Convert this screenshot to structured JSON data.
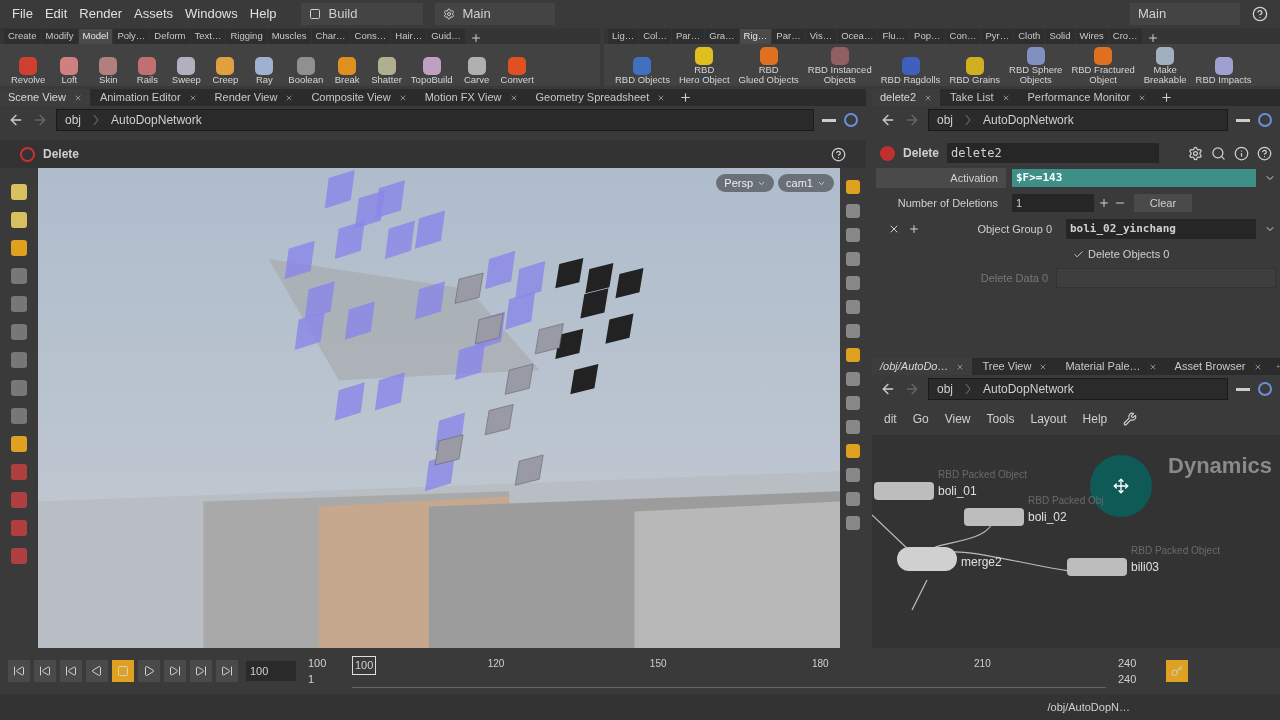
{
  "menu": [
    "File",
    "Edit",
    "Render",
    "Assets",
    "Windows",
    "Help"
  ],
  "desktop": "Build",
  "context": "Main",
  "right_context": "Main",
  "shelf_left": {
    "tabs": [
      {
        "label": "Create",
        "selected": false
      },
      {
        "label": "Modify",
        "selected": false
      },
      {
        "label": "Model",
        "selected": true
      },
      {
        "label": "Poly…",
        "selected": false
      },
      {
        "label": "Deform",
        "selected": false
      },
      {
        "label": "Text…",
        "selected": false
      },
      {
        "label": "Rigging",
        "selected": false
      },
      {
        "label": "Muscles",
        "selected": false
      },
      {
        "label": "Char…",
        "selected": false
      },
      {
        "label": "Cons…",
        "selected": false
      },
      {
        "label": "Hair…",
        "selected": false
      },
      {
        "label": "Guid…",
        "selected": false
      }
    ],
    "tools": [
      {
        "label": "Revolve",
        "color": "#d04030"
      },
      {
        "label": "Loft",
        "color": "#d08080"
      },
      {
        "label": "Skin",
        "color": "#b08080"
      },
      {
        "label": "Rails",
        "color": "#c07070"
      },
      {
        "label": "Sweep",
        "color": "#b0b0c0"
      },
      {
        "label": "Creep",
        "color": "#e0a040"
      },
      {
        "label": "Ray",
        "color": "#a0b0d0"
      },
      {
        "label": "Boolean",
        "color": "#909090"
      },
      {
        "label": "Break",
        "color": "#e09020"
      },
      {
        "label": "Shatter",
        "color": "#b0b090"
      },
      {
        "label": "TopoBuild",
        "color": "#c0a0c0"
      },
      {
        "label": "Carve",
        "color": "#b0b0b0"
      },
      {
        "label": "Convert",
        "color": "#e05020"
      }
    ]
  },
  "shelf_right": {
    "tabs": [
      {
        "label": "Lig…",
        "selected": false
      },
      {
        "label": "Col…",
        "selected": false
      },
      {
        "label": "Par…",
        "selected": false
      },
      {
        "label": "Gra…",
        "selected": false
      },
      {
        "label": "Rig…",
        "selected": true
      },
      {
        "label": "Par…",
        "selected": false
      },
      {
        "label": "Vis…",
        "selected": false
      },
      {
        "label": "Ocea…",
        "selected": false
      },
      {
        "label": "Flu…",
        "selected": false
      },
      {
        "label": "Pop…",
        "selected": false
      },
      {
        "label": "Con…",
        "selected": false
      },
      {
        "label": "Pyr…",
        "selected": false
      },
      {
        "label": "Cloth",
        "selected": false
      },
      {
        "label": "Solid",
        "selected": false
      },
      {
        "label": "Wires",
        "selected": false
      },
      {
        "label": "Cro…",
        "selected": false
      }
    ],
    "tools": [
      {
        "label": "RBD Objects",
        "color": "#4070c0"
      },
      {
        "label": "RBD\nHero Object",
        "color": "#e0c020"
      },
      {
        "label": "RBD\nGlued Objects",
        "color": "#e07020"
      },
      {
        "label": "RBD Instanced\nObjects",
        "color": "#906060"
      },
      {
        "label": "RBD Ragdolls",
        "color": "#4060c0"
      },
      {
        "label": "RBD Grains",
        "color": "#d0b020"
      },
      {
        "label": "RBD Sphere\nObjects",
        "color": "#8090c0"
      },
      {
        "label": "RBD Fractured\nObject",
        "color": "#e07020"
      },
      {
        "label": "Make\nBreakable",
        "color": "#a0b0c0"
      },
      {
        "label": "RBD Impacts",
        "color": "#a0a0d0"
      }
    ]
  },
  "scene_pane": {
    "tabs": [
      {
        "label": "Scene View",
        "selected": true
      },
      {
        "label": "Animation Editor",
        "selected": false
      },
      {
        "label": "Render View",
        "selected": false
      },
      {
        "label": "Composite View",
        "selected": false
      },
      {
        "label": "Motion FX View",
        "selected": false
      },
      {
        "label": "Geometry Spreadsheet",
        "selected": false
      }
    ],
    "path": [
      "obj",
      "AutoDopNetwork"
    ],
    "operation": "Delete",
    "camera_menus": [
      "Persp",
      "cam1"
    ]
  },
  "params_pane": {
    "tabs": [
      {
        "label": "delete2",
        "selected": true
      },
      {
        "label": "Take List",
        "selected": false
      },
      {
        "label": "Performance Monitor",
        "selected": false
      }
    ],
    "path": [
      "obj",
      "AutoDopNetwork"
    ],
    "node_type": "Delete",
    "node_name": "delete2",
    "activation": {
      "label": "Activation",
      "value": "$F>=143"
    },
    "deletions": {
      "label": "Number of Deletions",
      "value": "1",
      "clear": "Clear"
    },
    "object_group": {
      "label": "Object Group 0",
      "value": "boli_02_yinchang"
    },
    "delete_objects": {
      "label": "Delete Objects 0",
      "checked": true
    },
    "delete_data": {
      "label": "Delete Data 0",
      "disabled": true
    }
  },
  "network_pane": {
    "tabs": [
      {
        "label": "/obj/AutoDo…",
        "selected": true
      },
      {
        "label": "Tree View",
        "selected": false
      },
      {
        "label": "Material Pale…",
        "selected": false
      },
      {
        "label": "Asset Browser",
        "selected": false
      }
    ],
    "path": [
      "obj",
      "AutoDopNetwork"
    ],
    "menu": [
      "dit",
      "Go",
      "View",
      "Tools",
      "Layout",
      "Help"
    ],
    "watermark": "Dynamics",
    "nodes": [
      {
        "kind": "rbd",
        "type": "RBD Packed Object",
        "name": "boli_01"
      },
      {
        "kind": "rbd",
        "type": "RBD Packed Obj",
        "name": "boli_02"
      },
      {
        "kind": "merge",
        "name": "merge2"
      },
      {
        "kind": "rbd",
        "type": "RBD Packed Object",
        "name": "bili03"
      }
    ]
  },
  "timeline": {
    "frame": "100",
    "range_start": "100",
    "range_sub": "1",
    "current": "100",
    "ticks": [
      "120",
      "150",
      "180",
      "210"
    ],
    "end": "240",
    "end_sub": "240"
  },
  "status": {
    "path": "/obj/AutoDopN…"
  }
}
